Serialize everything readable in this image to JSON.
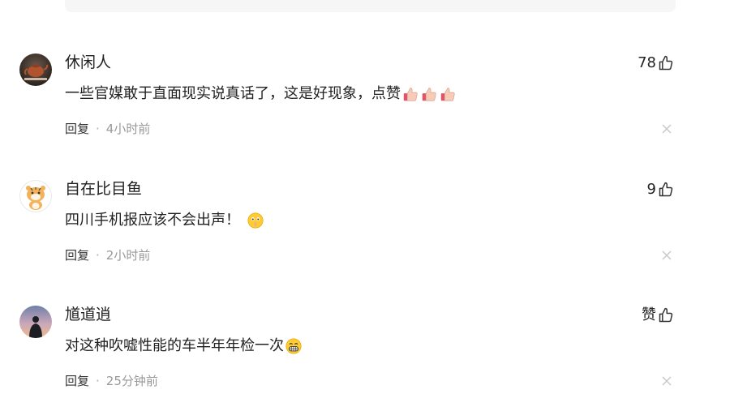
{
  "comments": [
    {
      "username": "休闲人",
      "like_count": "78",
      "text": "一些官媒敢于直面现实说真话了，这是好现象，点赞",
      "emojis": [
        "thumbs-up-emoji",
        "thumbs-up-emoji",
        "thumbs-up-emoji"
      ],
      "reply_label": "回复",
      "separator": "·",
      "time": "4小时前",
      "avatar": "teapot-avatar"
    },
    {
      "username": "自在比目鱼",
      "like_count": "9",
      "text": "四川手机报应该不会出声！",
      "emojis": [
        "shushing-face-emoji"
      ],
      "reply_label": "回复",
      "separator": "·",
      "time": "2小时前",
      "avatar": "tiger-cartoon-avatar"
    },
    {
      "username": "馗道逍",
      "like_count": "赞",
      "text": "对这种吹嘘性能的车半年年检一次",
      "emojis": [
        "grimacing-face-emoji"
      ],
      "reply_label": "回复",
      "separator": "·",
      "time": "25分钟前",
      "avatar": "sunset-silhouette-avatar"
    }
  ],
  "colors": {
    "text": "#222222",
    "meta": "#999999",
    "icon": "#333333",
    "card_bg": "#f6f6f6"
  }
}
